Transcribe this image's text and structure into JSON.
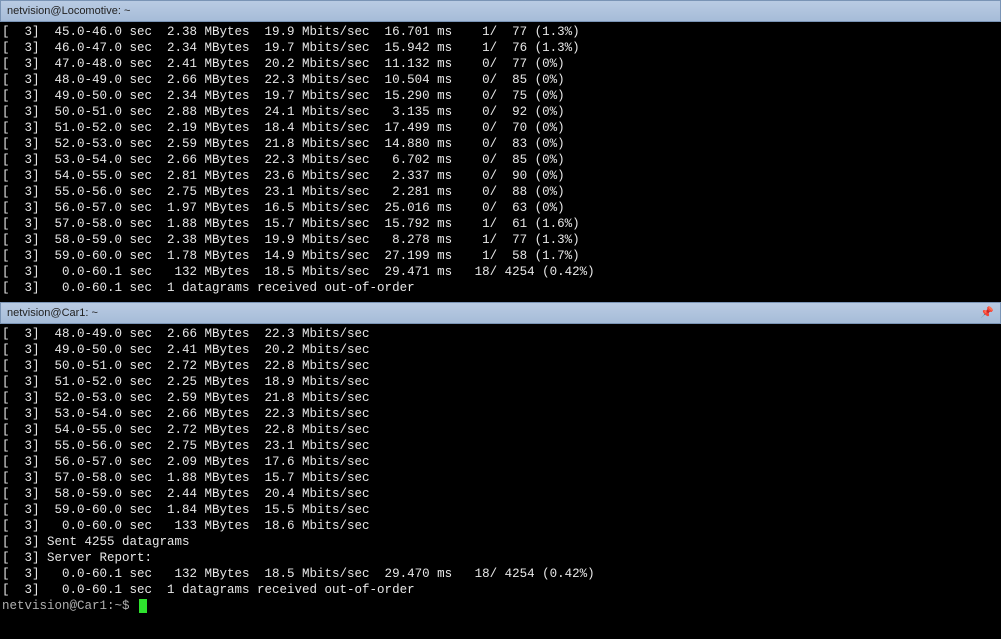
{
  "pane1": {
    "title": "netvision@Locomotive: ~",
    "rows": [
      {
        "id": 3,
        "interval": "45.0-46.0",
        "size": "2.38",
        "rate": "19.9",
        "jitter": "16.701",
        "lost": 1,
        "total": 77,
        "pct": "1.3%"
      },
      {
        "id": 3,
        "interval": "46.0-47.0",
        "size": "2.34",
        "rate": "19.7",
        "jitter": "15.942",
        "lost": 1,
        "total": 76,
        "pct": "1.3%"
      },
      {
        "id": 3,
        "interval": "47.0-48.0",
        "size": "2.41",
        "rate": "20.2",
        "jitter": "11.132",
        "lost": 0,
        "total": 77,
        "pct": "0%"
      },
      {
        "id": 3,
        "interval": "48.0-49.0",
        "size": "2.66",
        "rate": "22.3",
        "jitter": "10.504",
        "lost": 0,
        "total": 85,
        "pct": "0%"
      },
      {
        "id": 3,
        "interval": "49.0-50.0",
        "size": "2.34",
        "rate": "19.7",
        "jitter": "15.290",
        "lost": 0,
        "total": 75,
        "pct": "0%"
      },
      {
        "id": 3,
        "interval": "50.0-51.0",
        "size": "2.88",
        "rate": "24.1",
        "jitter": "3.135",
        "lost": 0,
        "total": 92,
        "pct": "0%"
      },
      {
        "id": 3,
        "interval": "51.0-52.0",
        "size": "2.19",
        "rate": "18.4",
        "jitter": "17.499",
        "lost": 0,
        "total": 70,
        "pct": "0%"
      },
      {
        "id": 3,
        "interval": "52.0-53.0",
        "size": "2.59",
        "rate": "21.8",
        "jitter": "14.880",
        "lost": 0,
        "total": 83,
        "pct": "0%"
      },
      {
        "id": 3,
        "interval": "53.0-54.0",
        "size": "2.66",
        "rate": "22.3",
        "jitter": "6.702",
        "lost": 0,
        "total": 85,
        "pct": "0%"
      },
      {
        "id": 3,
        "interval": "54.0-55.0",
        "size": "2.81",
        "rate": "23.6",
        "jitter": "2.337",
        "lost": 0,
        "total": 90,
        "pct": "0%"
      },
      {
        "id": 3,
        "interval": "55.0-56.0",
        "size": "2.75",
        "rate": "23.1",
        "jitter": "2.281",
        "lost": 0,
        "total": 88,
        "pct": "0%"
      },
      {
        "id": 3,
        "interval": "56.0-57.0",
        "size": "1.97",
        "rate": "16.5",
        "jitter": "25.016",
        "lost": 0,
        "total": 63,
        "pct": "0%"
      },
      {
        "id": 3,
        "interval": "57.0-58.0",
        "size": "1.88",
        "rate": "15.7",
        "jitter": "15.792",
        "lost": 1,
        "total": 61,
        "pct": "1.6%"
      },
      {
        "id": 3,
        "interval": "58.0-59.0",
        "size": "2.38",
        "rate": "19.9",
        "jitter": "8.278",
        "lost": 1,
        "total": 77,
        "pct": "1.3%"
      },
      {
        "id": 3,
        "interval": "59.0-60.0",
        "size": "1.78",
        "rate": "14.9",
        "jitter": "27.199",
        "lost": 1,
        "total": 58,
        "pct": "1.7%"
      },
      {
        "id": 3,
        "interval": "0.0-60.1",
        "size": "132",
        "rate": "18.5",
        "jitter": "29.471",
        "lost": 18,
        "total": 4254,
        "pct": "0.42%",
        "wide": true
      },
      {
        "id": 3,
        "interval": "0.0-60.1",
        "text": "1 datagrams received out-of-order"
      }
    ]
  },
  "pane2": {
    "title": "netvision@Car1: ~",
    "prompt": "netvision@Car1:~$",
    "simple_rows": [
      {
        "id": 3,
        "interval": "48.0-49.0",
        "size": "2.66",
        "rate": "22.3"
      },
      {
        "id": 3,
        "interval": "49.0-50.0",
        "size": "2.41",
        "rate": "20.2"
      },
      {
        "id": 3,
        "interval": "50.0-51.0",
        "size": "2.72",
        "rate": "22.8"
      },
      {
        "id": 3,
        "interval": "51.0-52.0",
        "size": "2.25",
        "rate": "18.9"
      },
      {
        "id": 3,
        "interval": "52.0-53.0",
        "size": "2.59",
        "rate": "21.8"
      },
      {
        "id": 3,
        "interval": "53.0-54.0",
        "size": "2.66",
        "rate": "22.3"
      },
      {
        "id": 3,
        "interval": "54.0-55.0",
        "size": "2.72",
        "rate": "22.8"
      },
      {
        "id": 3,
        "interval": "55.0-56.0",
        "size": "2.75",
        "rate": "23.1"
      },
      {
        "id": 3,
        "interval": "56.0-57.0",
        "size": "2.09",
        "rate": "17.6"
      },
      {
        "id": 3,
        "interval": "57.0-58.0",
        "size": "1.88",
        "rate": "15.7"
      },
      {
        "id": 3,
        "interval": "58.0-59.0",
        "size": "2.44",
        "rate": "20.4"
      },
      {
        "id": 3,
        "interval": "59.0-60.0",
        "size": "1.84",
        "rate": "15.5"
      },
      {
        "id": 3,
        "interval": "0.0-60.0",
        "size": "133",
        "rate": "18.6"
      }
    ],
    "extra_lines": [
      {
        "id": 3,
        "text": "Sent 4255 datagrams"
      },
      {
        "id": 3,
        "text": "Server Report:"
      }
    ],
    "report_row": {
      "id": 3,
      "interval": "0.0-60.1",
      "size": "132",
      "rate": "18.5",
      "jitter": "29.470",
      "lost": 18,
      "total": 4254,
      "pct": "0.42%",
      "wide": true
    },
    "ooo_row": {
      "id": 3,
      "interval": "0.0-60.1",
      "text": "1 datagrams received out-of-order"
    }
  },
  "units": {
    "sec": "sec",
    "mbytes": "MBytes",
    "mbits": "Mbits/sec",
    "ms": "ms"
  }
}
